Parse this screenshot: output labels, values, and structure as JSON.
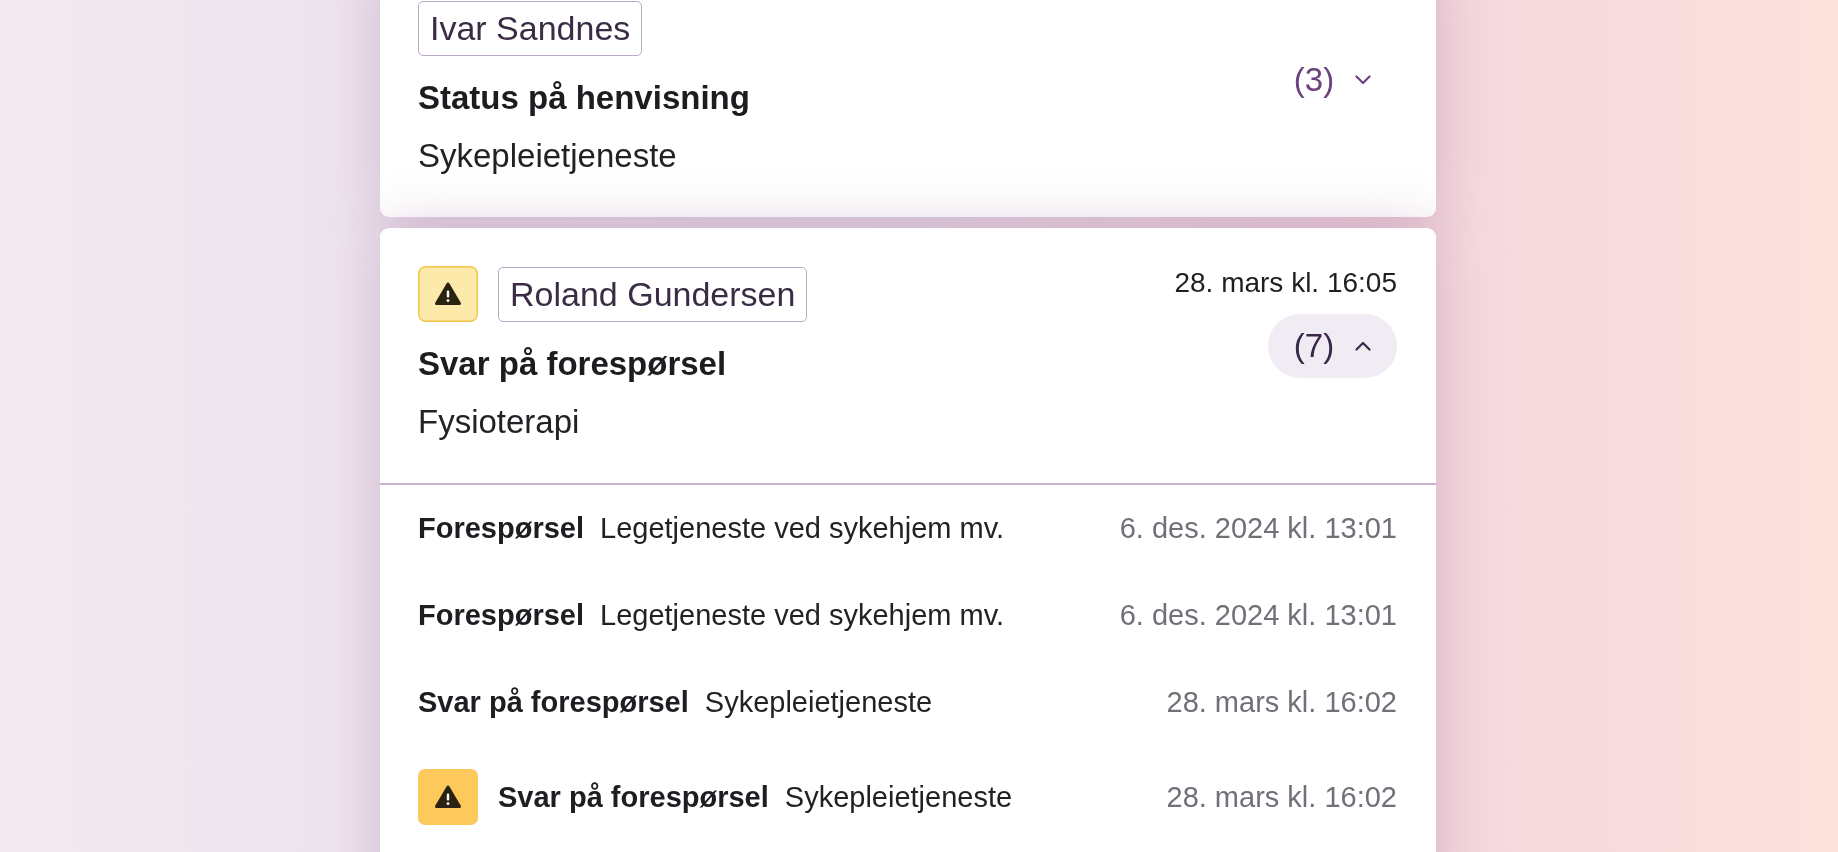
{
  "cards": [
    {
      "name": "Ivar Sandnes",
      "warning": false,
      "title": "Status på henvisning",
      "subtitle": "Sykepleietjeneste",
      "count": "(3)",
      "expanded": false
    },
    {
      "name": "Roland Gundersen",
      "warning": true,
      "date": "28. mars kl. 16:05",
      "title": "Svar på forespørsel",
      "subtitle": "Fysioterapi",
      "count": "(7)",
      "expanded": true,
      "events": [
        {
          "warning": false,
          "type": "Forespørsel",
          "description": "Legetjeneste ved sykehjem mv.",
          "date": "6. des. 2024 kl. 13:01"
        },
        {
          "warning": false,
          "type": "Forespørsel",
          "description": "Legetjeneste ved sykehjem mv.",
          "date": "6. des. 2024 kl. 13:01"
        },
        {
          "warning": false,
          "type": "Svar på forespørsel",
          "description": "Sykepleietjeneste",
          "date": "28. mars kl. 16:02"
        },
        {
          "warning": true,
          "type": "Svar på forespørsel",
          "description": "Sykepleietjeneste",
          "date": "28. mars kl. 16:02"
        }
      ]
    }
  ]
}
